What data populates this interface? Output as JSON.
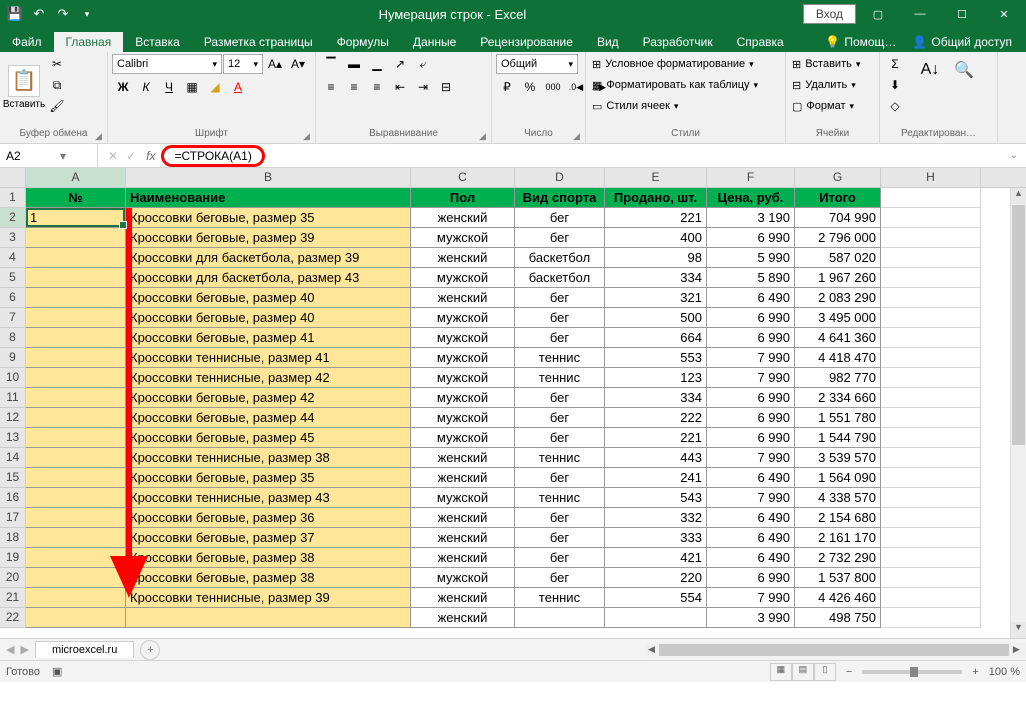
{
  "title": "Нумерация строк  -  Excel",
  "signin": "Вход",
  "tabs": [
    "Файл",
    "Главная",
    "Вставка",
    "Разметка страницы",
    "Формулы",
    "Данные",
    "Рецензирование",
    "Вид",
    "Разработчик",
    "Справка"
  ],
  "help_hint": "Помощ…",
  "share": "Общий доступ",
  "ribbon": {
    "paste": "Вставить",
    "clipboard": "Буфер обмена",
    "font_name": "Calibri",
    "font_size": "12",
    "font_group": "Шрифт",
    "align_group": "Выравнивание",
    "num_format": "Общий",
    "num_group": "Число",
    "cond": "Условное форматирование",
    "table": "Форматировать как таблицу",
    "cellstyle": "Стили ячеек",
    "style_group": "Стили",
    "insert": "Вставить",
    "delete": "Удалить",
    "format": "Формат",
    "cells_group": "Ячейки",
    "edit_group": "Редактирован…"
  },
  "name_box": "A2",
  "formula": "=СТРОКА(A1)",
  "columns": [
    "A",
    "B",
    "C",
    "D",
    "E",
    "F",
    "G",
    "H"
  ],
  "headers": {
    "no": "№",
    "name": "Наименование",
    "gender": "Пол",
    "sport": "Вид спорта",
    "sold": "Продано, шт.",
    "price": "Цена, руб.",
    "total": "Итого"
  },
  "row2_val": "1",
  "data_rows": [
    {
      "name": "Кроссовки беговые, размер 35",
      "g": "женский",
      "s": "бег",
      "q": "221",
      "p": "3 190",
      "t": "704 990"
    },
    {
      "name": "Кроссовки беговые, размер 39",
      "g": "мужской",
      "s": "бег",
      "q": "400",
      "p": "6 990",
      "t": "2 796 000"
    },
    {
      "name": "Кроссовки для баскетбола, размер 39",
      "g": "женский",
      "s": "баскетбол",
      "q": "98",
      "p": "5 990",
      "t": "587 020"
    },
    {
      "name": "Кроссовки для баскетбола, размер 43",
      "g": "мужской",
      "s": "баскетбол",
      "q": "334",
      "p": "5 890",
      "t": "1 967 260"
    },
    {
      "name": "Кроссовки беговые, размер 40",
      "g": "женский",
      "s": "бег",
      "q": "321",
      "p": "6 490",
      "t": "2 083 290"
    },
    {
      "name": "Кроссовки беговые, размер 40",
      "g": "мужской",
      "s": "бег",
      "q": "500",
      "p": "6 990",
      "t": "3 495 000"
    },
    {
      "name": "Кроссовки беговые, размер 41",
      "g": "мужской",
      "s": "бег",
      "q": "664",
      "p": "6 990",
      "t": "4 641 360"
    },
    {
      "name": "Кроссовки теннисные, размер 41",
      "g": "мужской",
      "s": "теннис",
      "q": "553",
      "p": "7 990",
      "t": "4 418 470"
    },
    {
      "name": "Кроссовки теннисные, размер 42",
      "g": "мужской",
      "s": "теннис",
      "q": "123",
      "p": "7 990",
      "t": "982 770"
    },
    {
      "name": "Кроссовки беговые, размер 42",
      "g": "мужской",
      "s": "бег",
      "q": "334",
      "p": "6 990",
      "t": "2 334 660"
    },
    {
      "name": "Кроссовки беговые, размер 44",
      "g": "мужской",
      "s": "бег",
      "q": "222",
      "p": "6 990",
      "t": "1 551 780"
    },
    {
      "name": "Кроссовки беговые, размер 45",
      "g": "мужской",
      "s": "бег",
      "q": "221",
      "p": "6 990",
      "t": "1 544 790"
    },
    {
      "name": "Кроссовки теннисные, размер 38",
      "g": "женский",
      "s": "теннис",
      "q": "443",
      "p": "7 990",
      "t": "3 539 570"
    },
    {
      "name": "Кроссовки беговые, размер 35",
      "g": "женский",
      "s": "бег",
      "q": "241",
      "p": "6 490",
      "t": "1 564 090"
    },
    {
      "name": "Кроссовки теннисные, размер 43",
      "g": "мужской",
      "s": "теннис",
      "q": "543",
      "p": "7 990",
      "t": "4 338 570"
    },
    {
      "name": "Кроссовки беговые, размер 36",
      "g": "женский",
      "s": "бег",
      "q": "332",
      "p": "6 490",
      "t": "2 154 680"
    },
    {
      "name": "Кроссовки беговые, размер 37",
      "g": "женский",
      "s": "бег",
      "q": "333",
      "p": "6 490",
      "t": "2 161 170"
    },
    {
      "name": "Кроссовки беговые, размер 38",
      "g": "женский",
      "s": "бег",
      "q": "421",
      "p": "6 490",
      "t": "2 732 290"
    },
    {
      "name": "Кроссовки беговые, размер 38",
      "g": "мужской",
      "s": "бег",
      "q": "220",
      "p": "6 990",
      "t": "1 537 800"
    },
    {
      "name": "Кроссовки теннисные, размер 39",
      "g": "женский",
      "s": "теннис",
      "q": "554",
      "p": "7 990",
      "t": "4 426 460"
    },
    {
      "name": "",
      "g": "женский",
      "s": "",
      "q": "",
      "p": "3 990",
      "t": "498 750"
    }
  ],
  "sheet": "microexcel.ru",
  "status": "Готово",
  "zoom": "100 %"
}
